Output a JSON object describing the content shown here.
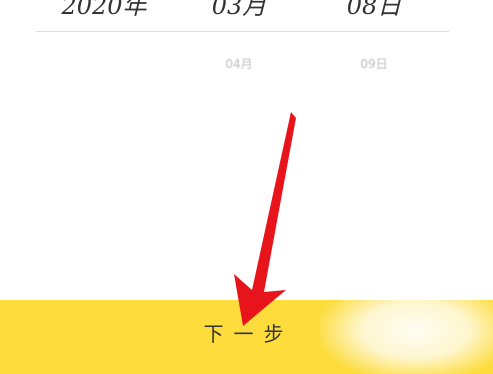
{
  "date_picker": {
    "selected": {
      "year": "2020年",
      "month": "03月",
      "day": "08日"
    },
    "next": {
      "month": "04月",
      "day": "09日"
    }
  },
  "next_button": {
    "label": "下一步",
    "color": "#fddc3b"
  },
  "annotation": {
    "arrow_color": "#e8141b",
    "icon": "arrow-pointing-down-icon"
  }
}
